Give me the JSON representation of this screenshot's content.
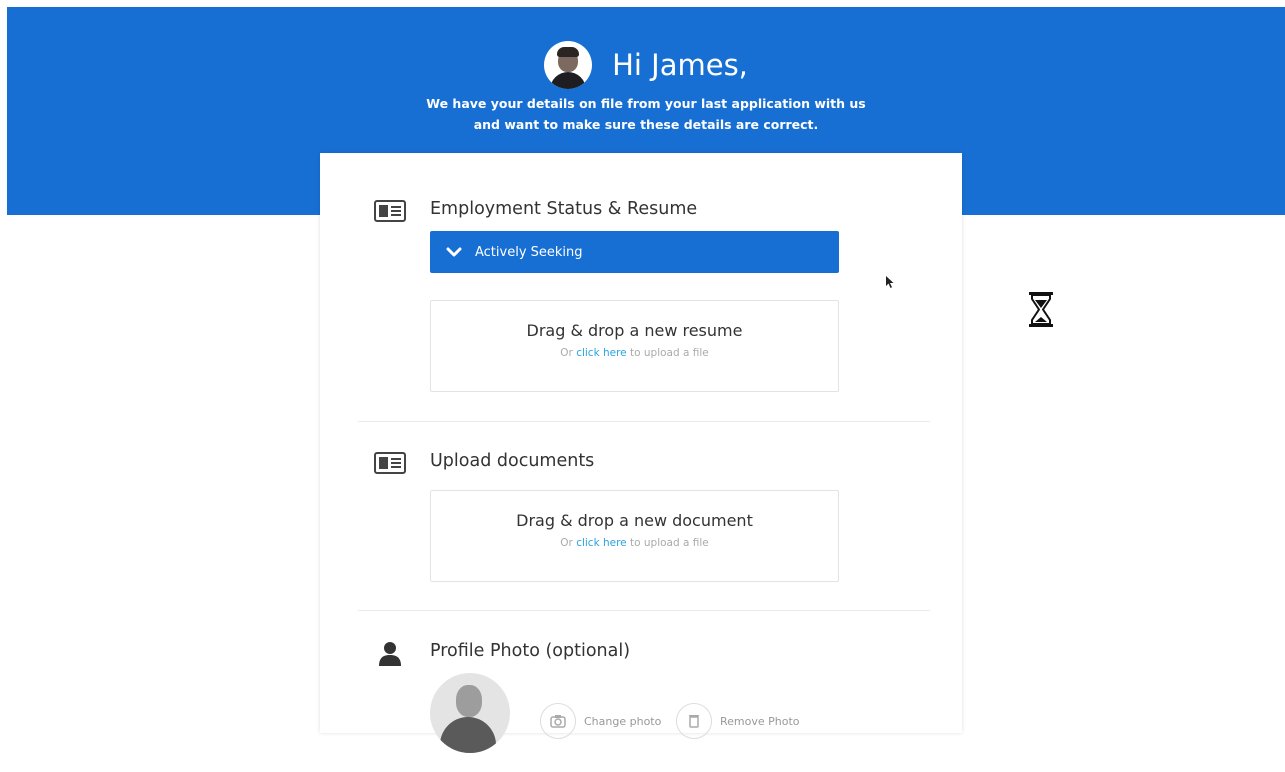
{
  "header": {
    "greeting": "Hi James,",
    "subtitle_line1": "We have your details on file from your last application with us",
    "subtitle_line2": "and want to make sure these details are correct."
  },
  "sections": {
    "employment": {
      "title": "Employment Status & Resume",
      "status_selected": "Actively Seeking",
      "dropzone_title": "Drag & drop a new resume",
      "dropzone_prefix": "Or ",
      "dropzone_link": "click here",
      "dropzone_suffix": " to upload a file"
    },
    "documents": {
      "title": "Upload documents",
      "dropzone_title": "Drag & drop a new document",
      "dropzone_prefix": "Or ",
      "dropzone_link": "click here",
      "dropzone_suffix": " to upload a file"
    },
    "photo": {
      "title": "Profile Photo (optional)",
      "change_label": "Change photo",
      "remove_label": "Remove Photo"
    }
  },
  "colors": {
    "brand_blue": "#176fd4",
    "link": "#2aa3e0"
  },
  "icons": {
    "section_icon": "id-card-icon",
    "photo_section_icon": "person-icon",
    "status_icon": "chevron-down-icon",
    "busy_indicator": "hourglass-icon"
  }
}
